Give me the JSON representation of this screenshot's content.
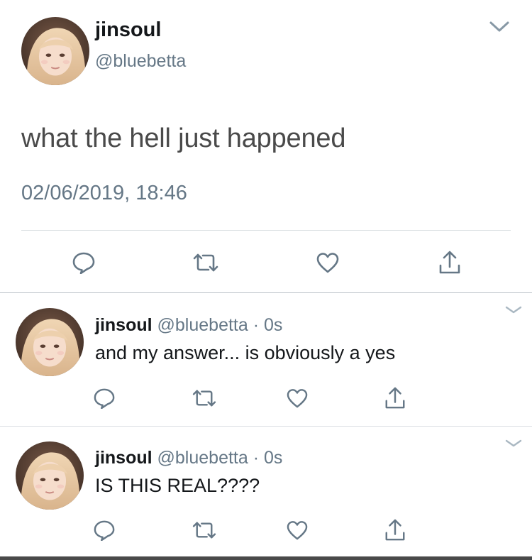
{
  "main_tweet": {
    "name": "jinsoul",
    "handle": "@bluebetta",
    "text": "what the hell just happened",
    "timestamp": "02/06/2019, 18:46",
    "actions": [
      "reply-icon",
      "retweet-icon",
      "like-icon",
      "share-icon"
    ]
  },
  "replies": [
    {
      "name": "jinsoul",
      "handle": "@bluebetta",
      "separator": "·",
      "time": "0s",
      "text": "and my answer... is obviously a yes"
    },
    {
      "name": "jinsoul",
      "handle": "@bluebetta",
      "separator": "·",
      "time": "0s",
      "text": "IS THIS REAL????"
    }
  ],
  "colors": {
    "text": "#14171a",
    "secondary": "#657786",
    "icon": "#657786",
    "divider": "#d9dee2"
  }
}
